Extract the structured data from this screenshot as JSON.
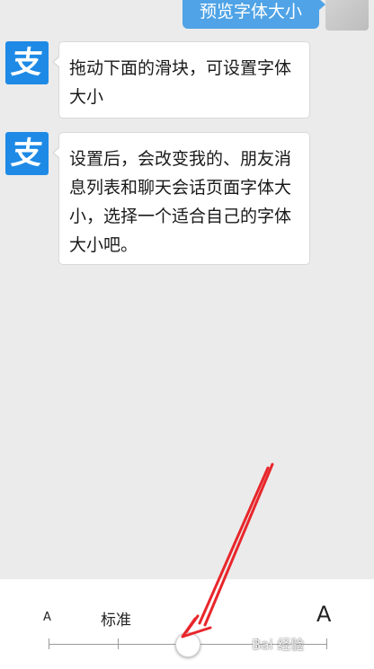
{
  "outgoing": {
    "text": "预览字体大小"
  },
  "messages": [
    {
      "avatar_glyph": "支",
      "text": "拖动下面的滑块，可设置字体大小"
    },
    {
      "avatar_glyph": "支",
      "text": "设置后，会改变我的、朋友消息列表和聊天会话页面字体大小，选择一个适合自己的字体大小吧。"
    }
  ],
  "font_panel": {
    "small_label": "A",
    "standard_label": "标准",
    "large_label": "A",
    "steps": 5,
    "selected_step": 3
  },
  "watermark": {
    "text": "Bai 经验"
  },
  "annotation": {
    "color": "#e8262b",
    "icon": "red-arrow"
  },
  "colors": {
    "alipay_blue": "#1e8ae6",
    "bubble_blue": "#4fa3e6"
  }
}
